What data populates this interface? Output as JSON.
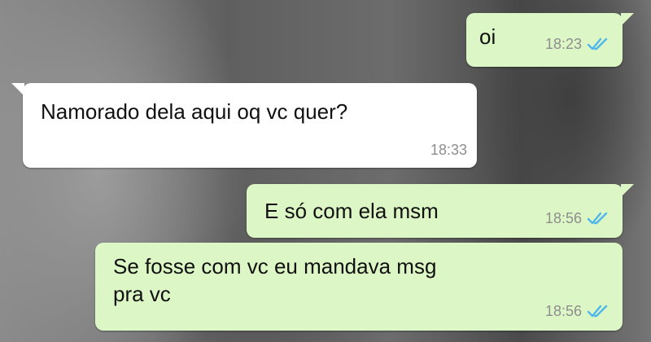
{
  "colors": {
    "outgoing_bubble": "#dcf7c5",
    "incoming_bubble": "#ffffff",
    "read_ticks": "#4fb6ec",
    "timestamp": "#8e8e8e"
  },
  "messages": [
    {
      "direction": "outgoing",
      "text": "oi",
      "time": "18:23",
      "status": "read"
    },
    {
      "direction": "incoming",
      "text": "Namorado dela aqui oq vc quer?",
      "time": "18:33"
    },
    {
      "direction": "outgoing",
      "text": "E só com ela msm",
      "time": "18:56",
      "status": "read"
    },
    {
      "direction": "outgoing",
      "text": "Se fosse com vc eu mandava msg\npra vc",
      "time": "18:56",
      "status": "read"
    }
  ]
}
